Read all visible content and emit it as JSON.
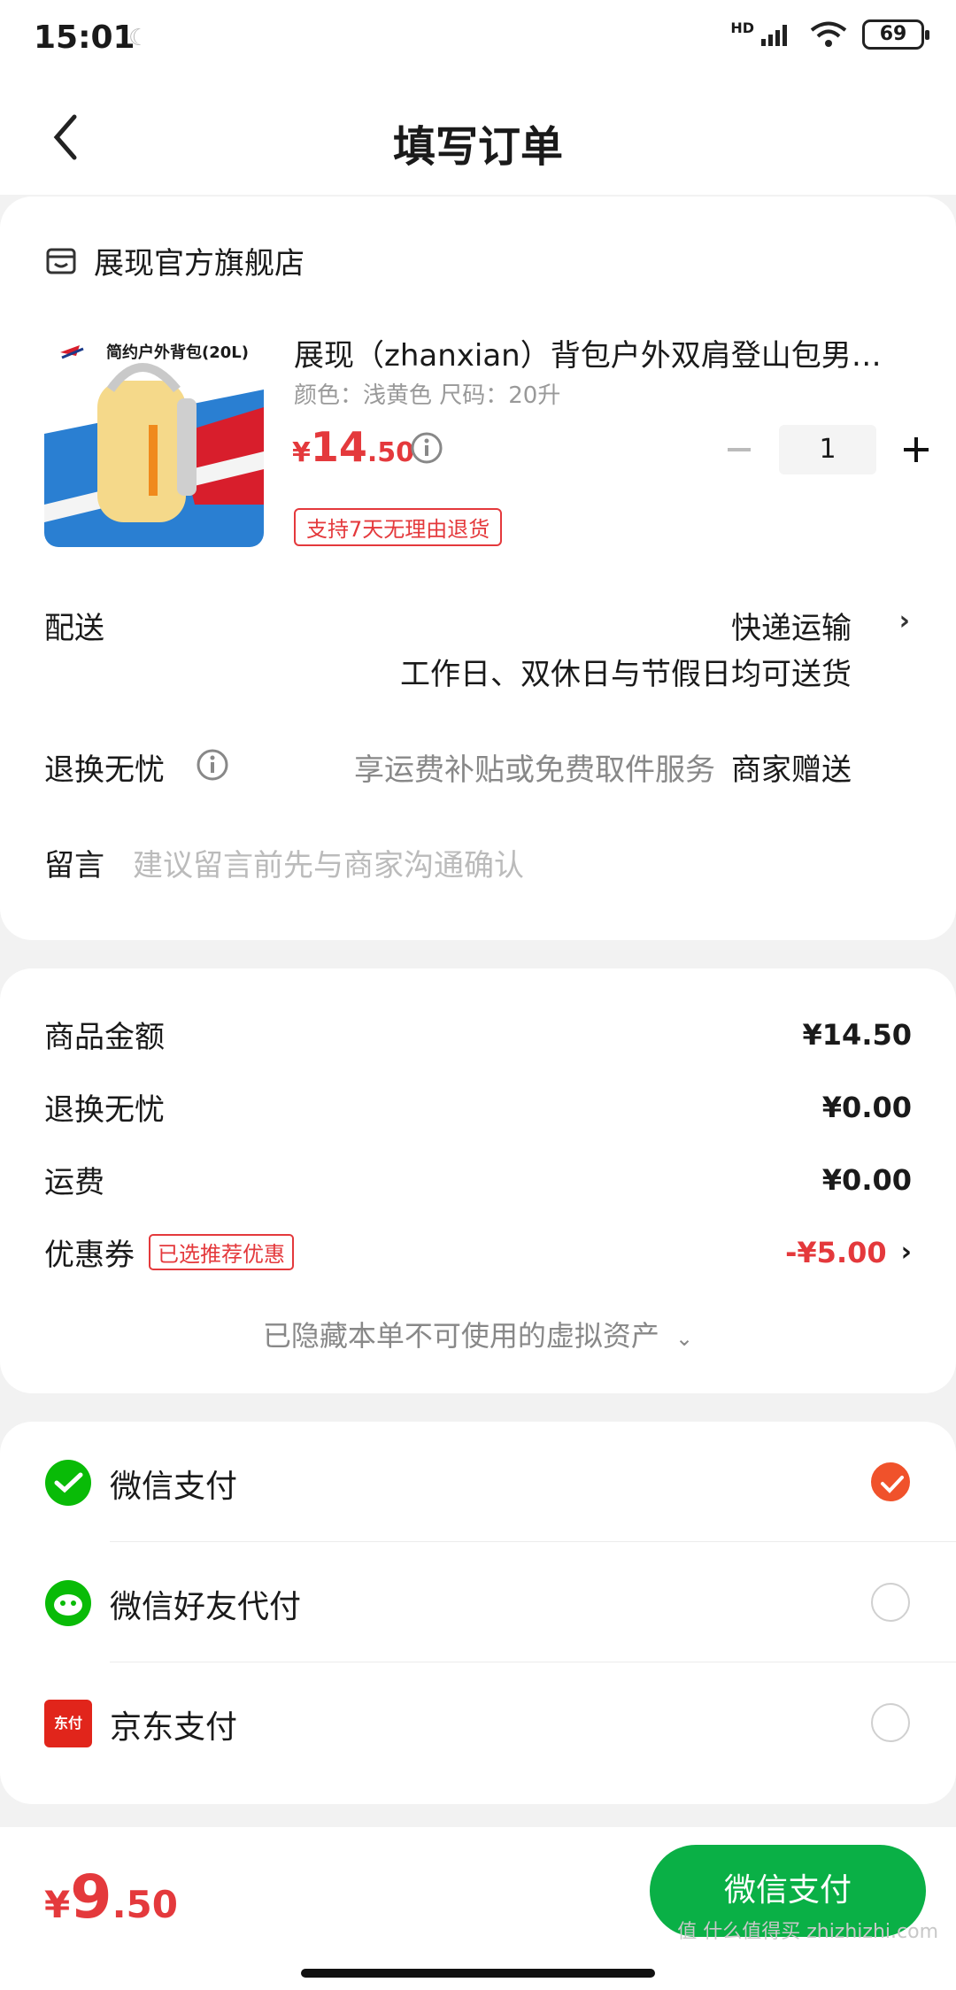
{
  "status": {
    "time": "15:01",
    "network": "HD",
    "battery": "69"
  },
  "nav": {
    "title": "填写订单"
  },
  "shop": {
    "name": "展现官方旗舰店"
  },
  "product": {
    "image_title": "简约户外背包(20L)",
    "title": "展现（zhanxian）背包户外双肩登山包男…",
    "spec": "颜色：浅黄色   尺码：20升",
    "price_currency": "¥",
    "price_int": "14",
    "price_dec": ".50",
    "quantity": "1",
    "return_policy": "支持7天无理由退货"
  },
  "delivery": {
    "label": "配送",
    "value": "快递运输",
    "sub": "工作日、双休日与节假日均可送货"
  },
  "exchange": {
    "label": "退换无忧",
    "desc": "享运费补贴或免费取件服务",
    "gift": "商家赠送"
  },
  "note": {
    "label": "留言",
    "placeholder": "建议留言前先与商家沟通确认"
  },
  "summary": {
    "goods_label": "商品金额",
    "goods_value": "¥14.50",
    "exchange_label": "退换无忧",
    "exchange_value": "¥0.00",
    "shipping_label": "运费",
    "shipping_value": "¥0.00",
    "coupon_label": "优惠券",
    "coupon_badge": "已选推荐优惠",
    "coupon_value": "-¥5.00",
    "hidden_assets": "已隐藏本单不可使用的虚拟资产"
  },
  "payment": {
    "options": [
      {
        "label": "微信支付",
        "selected": true
      },
      {
        "label": "微信好友代付",
        "selected": false
      },
      {
        "label": "京东支付",
        "selected": false
      }
    ],
    "jd_icon_text": "东付"
  },
  "footer": {
    "total_currency": "¥",
    "total_int": "9",
    "total_dec": ".50",
    "pay_button": "微信支付",
    "watermark": "值 什么值得买 zhizhizhi.com"
  },
  "colors": {
    "accent_red": "#e4393c",
    "wechat_green": "#0ab046",
    "radio_orange": "#f0522b"
  }
}
